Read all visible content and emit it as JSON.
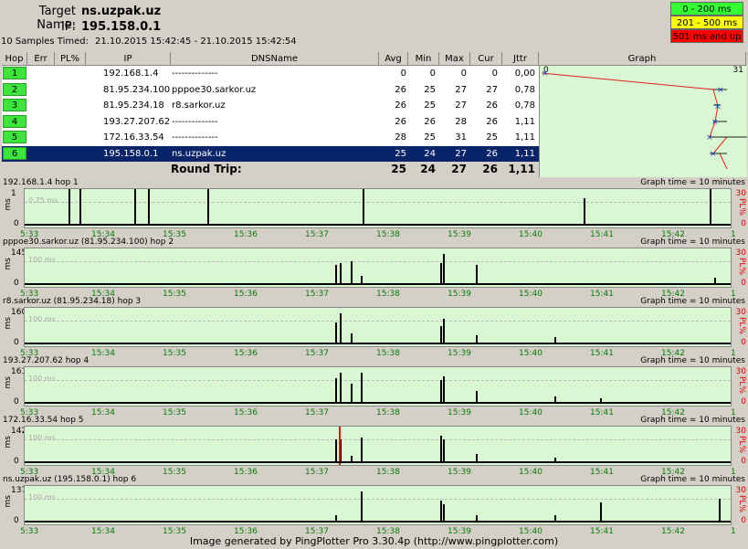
{
  "header": {
    "target_label": "Target Name:",
    "target_value": "ns.uzpak.uz",
    "ip_label": "IP:",
    "ip_value": "195.158.0.1",
    "samples_label": "10 Samples Timed:",
    "samples_value": "21.10.2015 15:42:45 - 21.10.2015 15:42:54"
  },
  "legend": [
    {
      "label": "0 - 200 ms",
      "color": "#33ff33"
    },
    {
      "label": "201 - 500 ms",
      "color": "#ffff00"
    },
    {
      "label": "501 ms and up",
      "color": "#ff0000"
    }
  ],
  "table": {
    "columns": [
      "Hop",
      "Err",
      "PL%",
      "IP",
      "DNSName",
      "Avg",
      "Min",
      "Max",
      "Cur",
      "Jttr",
      "Graph"
    ],
    "graph_scale_left": "0",
    "graph_scale_right": "31",
    "rows": [
      {
        "hop": "1",
        "err": "",
        "pl": "",
        "ip": "192.168.1.4",
        "dns": "--------------",
        "avg": "0",
        "min": "0",
        "max": "0",
        "cur": "0",
        "jttr": "0,00"
      },
      {
        "hop": "2",
        "err": "",
        "pl": "",
        "ip": "81.95.234.100",
        "dns": "pppoe30.sarkor.uz",
        "avg": "26",
        "min": "25",
        "max": "27",
        "cur": "27",
        "jttr": "0,78"
      },
      {
        "hop": "3",
        "err": "",
        "pl": "",
        "ip": "81.95.234.18",
        "dns": "r8.sarkor.uz",
        "avg": "26",
        "min": "25",
        "max": "27",
        "cur": "26",
        "jttr": "0,78"
      },
      {
        "hop": "4",
        "err": "",
        "pl": "",
        "ip": "193.27.207.62",
        "dns": "--------------",
        "avg": "26",
        "min": "26",
        "max": "28",
        "cur": "26",
        "jttr": "1,11"
      },
      {
        "hop": "5",
        "err": "",
        "pl": "",
        "ip": "172.16.33.54",
        "dns": "--------------",
        "avg": "28",
        "min": "25",
        "max": "31",
        "cur": "25",
        "jttr": "1,11"
      },
      {
        "hop": "6",
        "err": "",
        "pl": "",
        "ip": "195.158.0.1",
        "dns": "ns.uzpak.uz",
        "avg": "25",
        "min": "24",
        "max": "27",
        "cur": "26",
        "jttr": "1,11"
      }
    ],
    "round_trip": {
      "label": "Round Trip:",
      "avg": "25",
      "min": "24",
      "max": "27",
      "cur": "26",
      "jttr": "1,11"
    }
  },
  "panels": [
    {
      "title": "192.168.1.4 hop 1",
      "graph_time": "Graph time = 10 minutes",
      "ymax": "1",
      "ref": "0,75 ms",
      "yunit": "ms",
      "pl_top": "30",
      "pl_label": "PL%"
    },
    {
      "title": "pppoe30.sarkor.uz (81.95.234.100) hop 2",
      "graph_time": "Graph time = 10 minutes",
      "ymax": "145",
      "ref": "100 ms",
      "yunit": "ms",
      "pl_top": "30",
      "pl_label": "PL%"
    },
    {
      "title": "r8.sarkor.uz (81.95.234.18) hop 3",
      "graph_time": "Graph time = 10 minutes",
      "ymax": "160",
      "ref": "100 ms",
      "yunit": "ms",
      "pl_top": "30",
      "pl_label": "PL%"
    },
    {
      "title": "193.27.207.62 hop 4",
      "graph_time": "Graph time = 10 minutes",
      "ymax": "161",
      "ref": "100 ms",
      "yunit": "ms",
      "pl_top": "30",
      "pl_label": "PL%"
    },
    {
      "title": "172.16.33.54 hop 5",
      "graph_time": "Graph time = 10 minutes",
      "ymax": "142",
      "ref": "100 ms",
      "yunit": "ms",
      "pl_top": "30",
      "pl_label": "PL%"
    },
    {
      "title": "ns.uzpak.uz (195.158.0.1) hop 6",
      "graph_time": "Graph time = 10 minutes",
      "ymax": "137",
      "ref": "100 ms",
      "yunit": "ms",
      "pl_top": "30",
      "pl_label": "PL%"
    }
  ],
  "time_ticks": [
    "5:33",
    "15:34",
    "15:35",
    "15:36",
    "15:37",
    "15:38",
    "15:39",
    "15:40",
    "15:41",
    "15:42",
    "1"
  ],
  "panel_ymin": "0",
  "pl_bottom": "0",
  "footer": "Image generated by PingPlotter Pro 3.30.4p (http://www.pingplotter.com)"
}
